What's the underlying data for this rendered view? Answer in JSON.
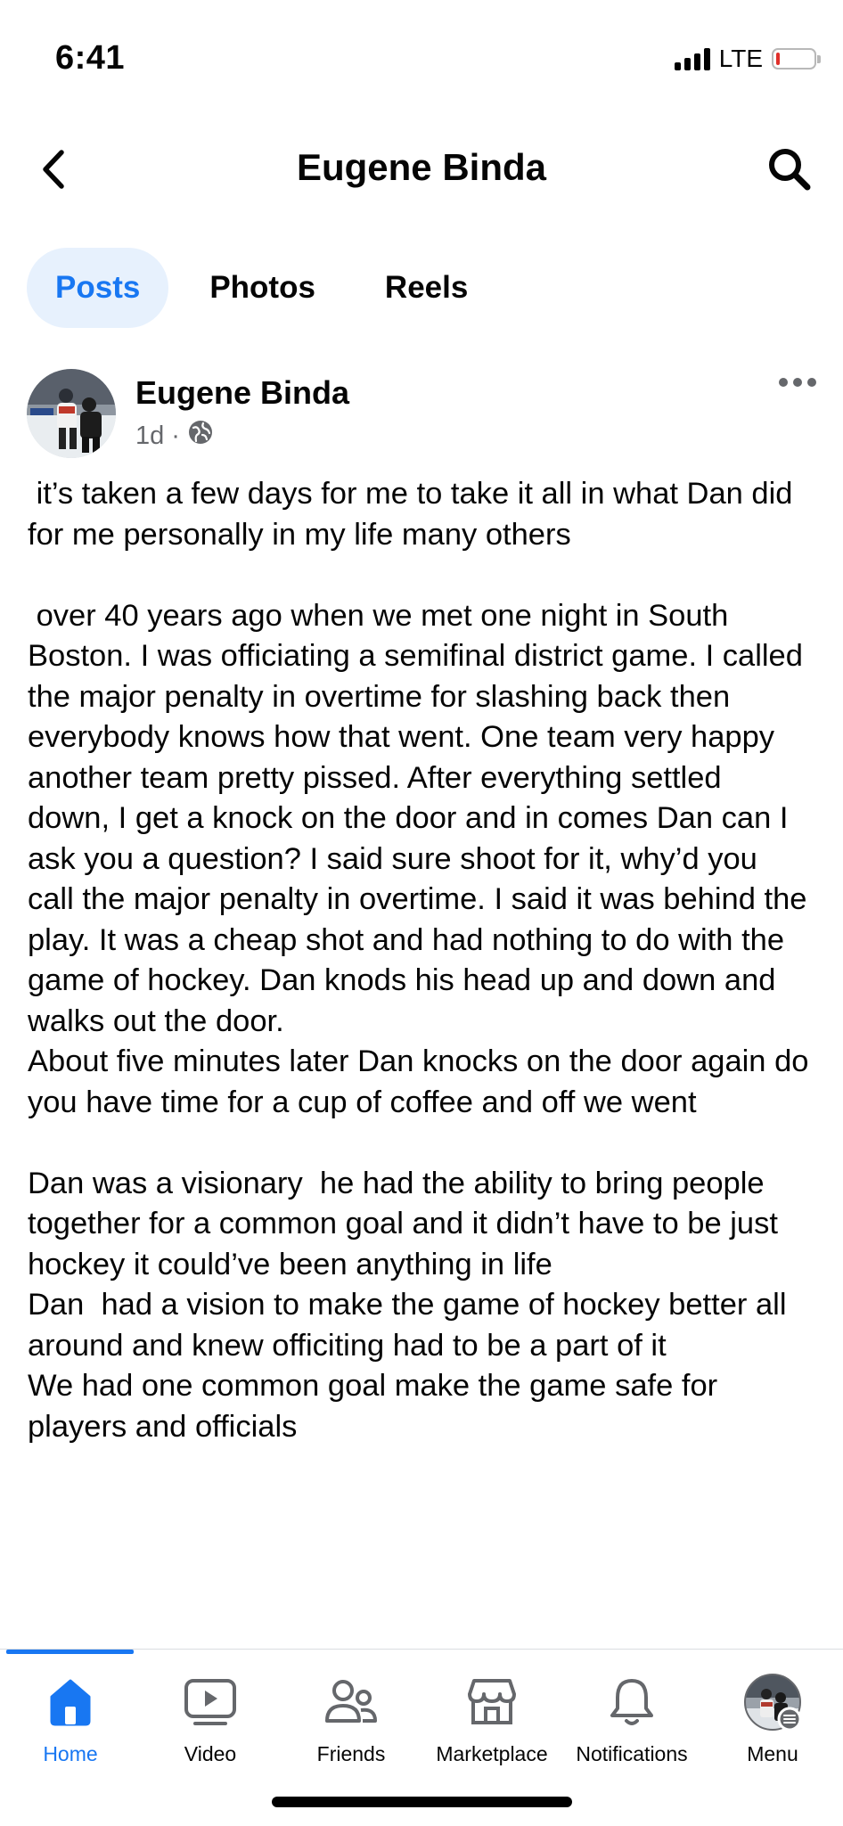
{
  "status": {
    "time": "6:41",
    "network": "LTE"
  },
  "header": {
    "title": "Eugene Binda",
    "back_icon": "chevron-left-icon",
    "search_icon": "search-icon"
  },
  "tabs": [
    {
      "label": "Posts",
      "active": true
    },
    {
      "label": "Photos",
      "active": false
    },
    {
      "label": "Reels",
      "active": false
    }
  ],
  "post": {
    "author": "Eugene Binda",
    "time": "1d",
    "audience_icon": "globe-icon",
    "text": " it’s taken a few days for me to take it all in what Dan did for me personally in my life many others\n\n over 40 years ago when we met one night in South Boston. I was officiating a semifinal district game. I called the major penalty in overtime for slashing back then everybody knows how that went. One team very happy another team pretty pissed. After everything settled down, I get a knock on the door and in comes Dan can I ask you a question? I said sure shoot for it, why’d you call the major penalty in overtime. I said it was behind the play. It was a cheap shot and had nothing to do with the game of hockey. Dan knods his head up and down and walks out the door.\nAbout five minutes later Dan knocks on the door again do you have time for a cup of coffee and off we went\n\nDan was a visionary  he had the ability to bring people together for a common goal and it didn’t have to be just hockey it could’ve been anything in life\nDan  had a vision to make the game of hockey better all around and knew officiting had to be a part of it\nWe had one common goal make the game safe for players and officials"
  },
  "bottom_nav": [
    {
      "label": "Home",
      "icon": "home-icon",
      "active": true
    },
    {
      "label": "Video",
      "icon": "video-icon",
      "active": false
    },
    {
      "label": "Friends",
      "icon": "friends-icon",
      "active": false
    },
    {
      "label": "Marketplace",
      "icon": "marketplace-icon",
      "active": false
    },
    {
      "label": "Notifications",
      "icon": "bell-icon",
      "active": false
    },
    {
      "label": "Menu",
      "icon": "profile-avatar-icon",
      "active": false
    }
  ],
  "colors": {
    "accent": "#1877f2",
    "accent_bg": "#e7f1fd",
    "text": "#050505",
    "secondary_text": "#65676b"
  }
}
